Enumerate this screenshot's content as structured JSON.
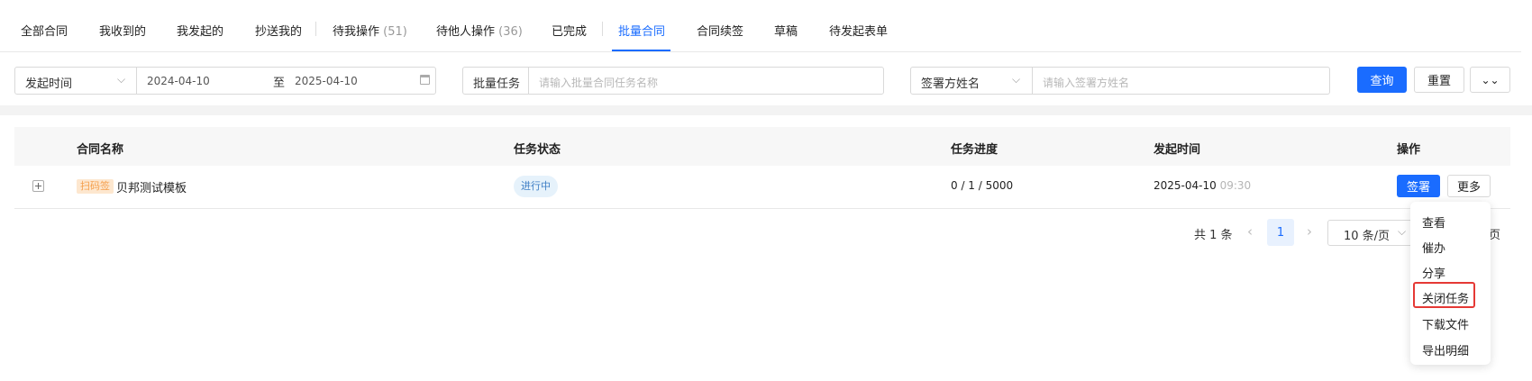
{
  "tabs": {
    "all": "全部合同",
    "received": "我收到的",
    "initiated": "我发起的",
    "cc": "抄送我的",
    "pending_me": "待我操作",
    "pending_me_count": "(51)",
    "pending_others": "待他人操作",
    "pending_others_count": "(36)",
    "completed": "已完成",
    "batch": "批量合同",
    "renewal": "合同续签",
    "draft": "草稿",
    "pending_form": "待发起表单"
  },
  "filters": {
    "date_type": "发起时间",
    "date_start": "2024-04-10",
    "date_sep": "至",
    "date_end": "2025-04-10",
    "batch_label": "批量任务",
    "batch_placeholder": "请输入批量合同任务名称",
    "signer_type": "签署方姓名",
    "signer_placeholder": "请输入签署方姓名",
    "query": "查询",
    "reset": "重置",
    "expand_icon": "double-chevron-down-icon"
  },
  "table": {
    "columns": {
      "name": "合同名称",
      "status": "任务状态",
      "progress": "任务进度",
      "time": "发起时间",
      "actions": "操作"
    },
    "rows": [
      {
        "tag": "扫码签",
        "name": "贝邦测试模板",
        "status": "进行中",
        "progress": "0 / 1 / 5000",
        "date": "2025-04-10",
        "time": "09:30",
        "sign": "签署",
        "more": "更多"
      }
    ]
  },
  "pagination": {
    "total": "共 1 条",
    "current": "1",
    "page_size": "10 条/页",
    "tail": "页"
  },
  "menu": {
    "items": [
      "查看",
      "催办",
      "分享",
      "关闭任务",
      "下载文件",
      "导出明细"
    ],
    "highlighted": "关闭任务"
  },
  "colors": {
    "accent": "#1a6cff",
    "highlight": "#e53935",
    "tag_bg": "#fde7cf",
    "status_bg": "#e6f2fb"
  }
}
